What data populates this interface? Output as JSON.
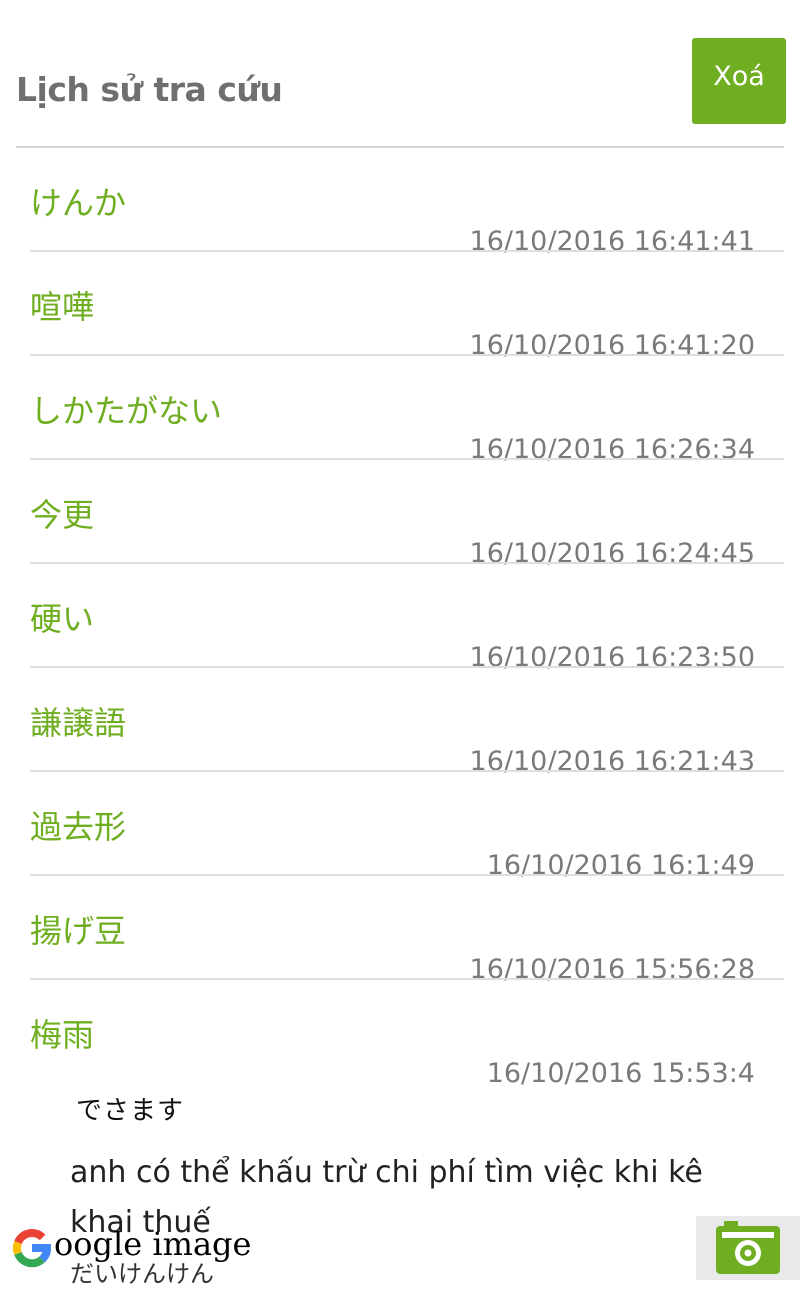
{
  "header": {
    "title": "Lịch sử tra cứu",
    "clear_label": "Xoá"
  },
  "history": [
    {
      "word": "けんか",
      "time": "16/10/2016 16:41:41"
    },
    {
      "word": "喧嘩",
      "time": "16/10/2016 16:41:20"
    },
    {
      "word": "しかたがない",
      "time": "16/10/2016 16:26:34"
    },
    {
      "word": "今更",
      "time": "16/10/2016 16:24:45"
    },
    {
      "word": "硬い",
      "time": "16/10/2016 16:23:50"
    },
    {
      "word": "謙譲語",
      "time": "16/10/2016 16:21:43"
    },
    {
      "word": "過去形",
      "time": "16/10/2016 16:1:49"
    },
    {
      "word": "揚げ豆",
      "time": "16/10/2016 15:56:28"
    },
    {
      "word": "梅雨",
      "time": "16/10/2016 15:53:4"
    }
  ],
  "overlay": {
    "line1": "でさます",
    "line2": "anh có thể khấu trừ chi phí tìm việc khi kê khai thuế",
    "line3": "だいけんけん"
  },
  "google_image": {
    "label": "oogle image",
    "icon": "google-g-icon"
  },
  "camera": {
    "icon": "camera-icon"
  },
  "colors": {
    "accent": "#6fae20",
    "title": "#6f6f6f",
    "timestamp": "#7a7a7a",
    "divider": "#dedede"
  }
}
